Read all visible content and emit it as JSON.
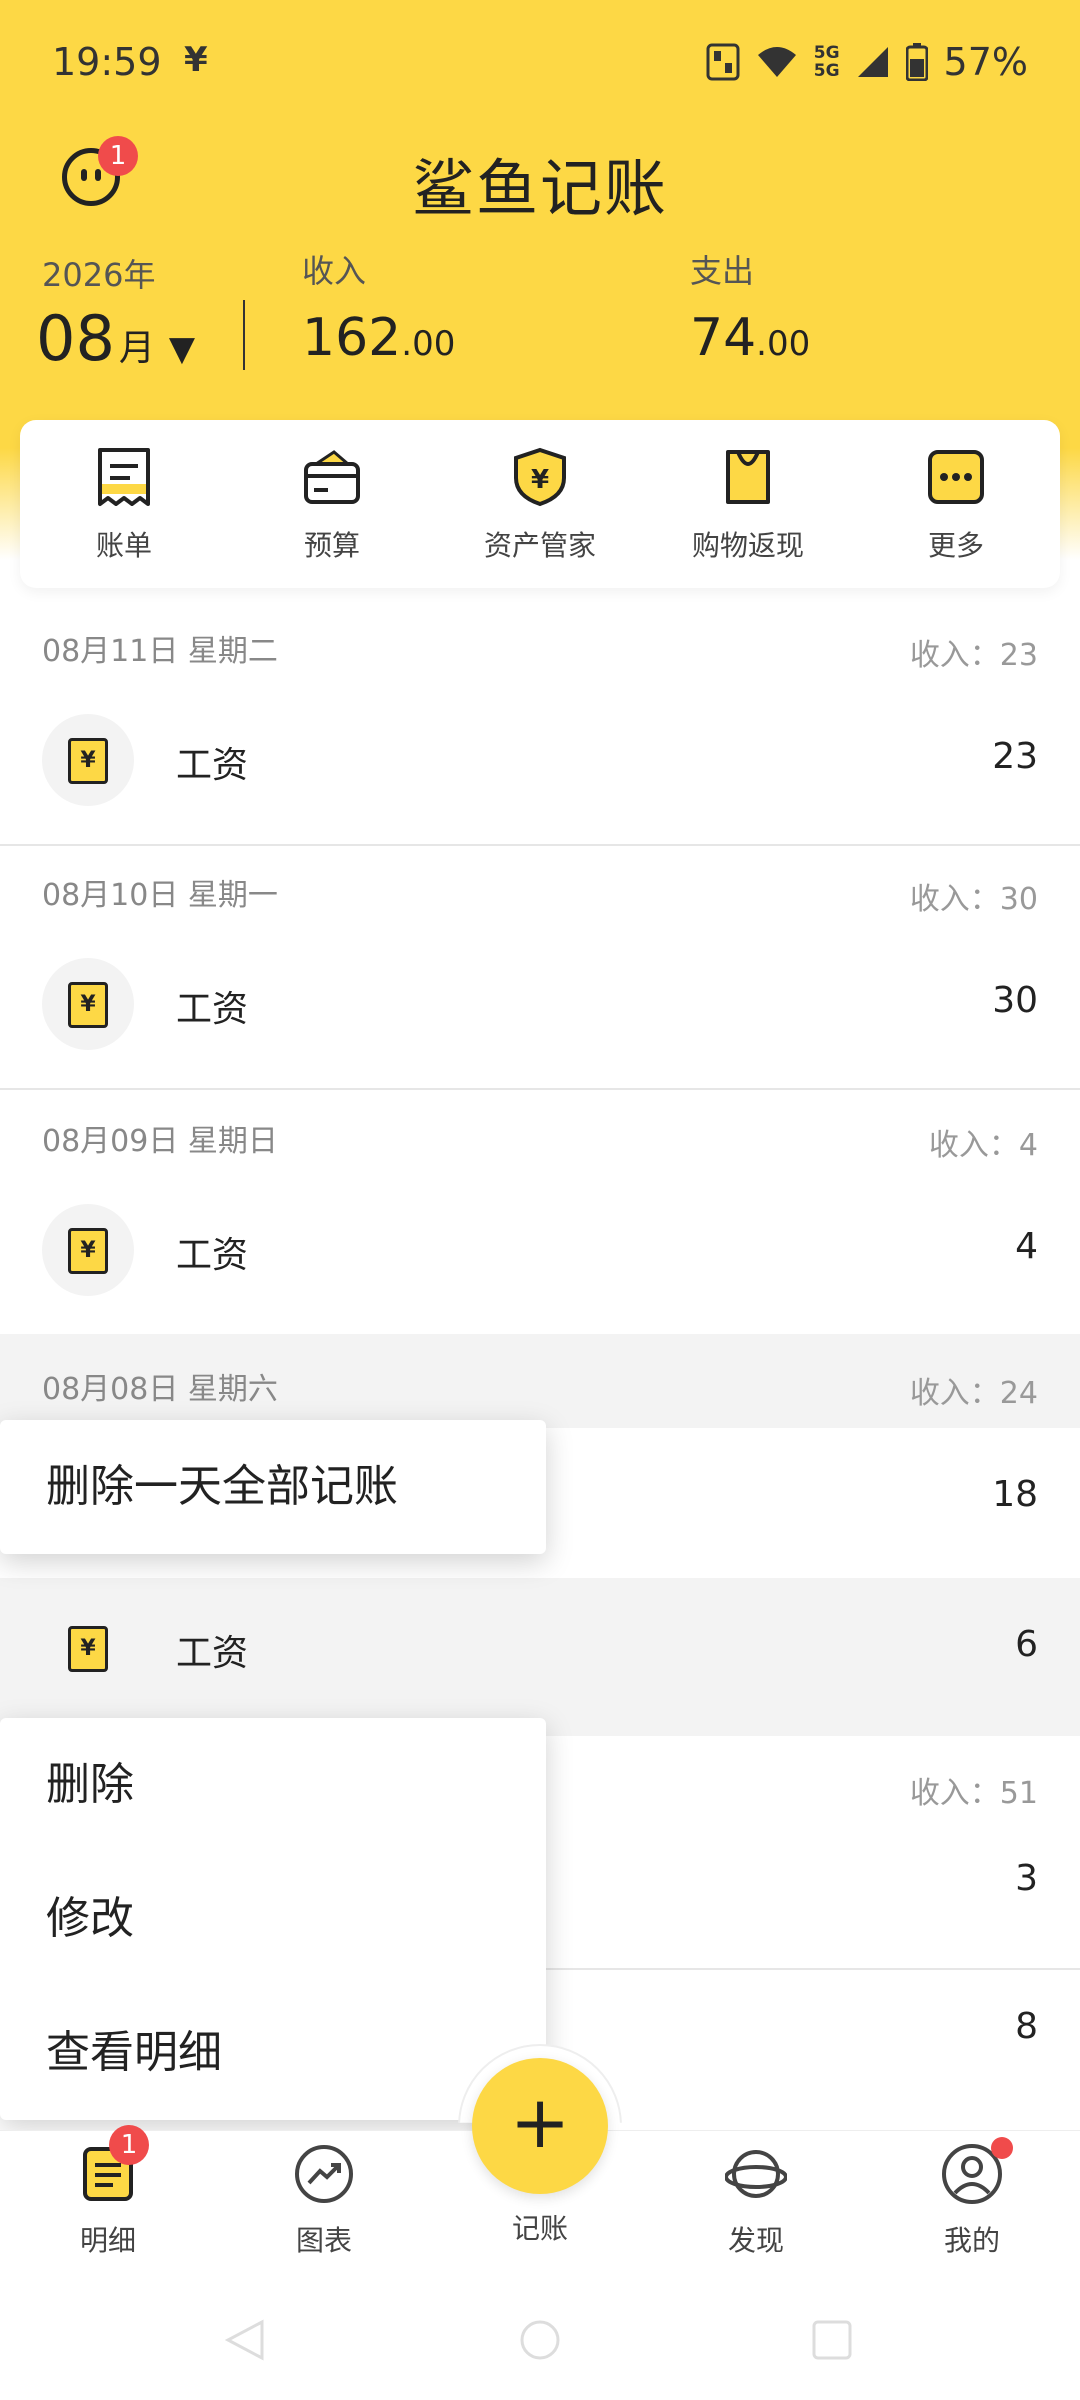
{
  "status_bar": {
    "time": "19:59",
    "yen_glyph": "¥",
    "battery": "57%",
    "net_label_top": "5G",
    "net_label_bottom": "5G"
  },
  "header": {
    "title": "鲨鱼记账",
    "notification_badge": "1",
    "year": "2026年",
    "month": "08",
    "month_unit": "月",
    "month_caret": "▼",
    "income_label": "收入",
    "income_int": "162",
    "income_dec": ".00",
    "expense_label": "支出",
    "expense_int": "74",
    "expense_dec": ".00"
  },
  "actions": [
    {
      "label": "账单",
      "icon": "bill-icon"
    },
    {
      "label": "预算",
      "icon": "wallet-icon"
    },
    {
      "label": "资产管家",
      "icon": "shield-yen-icon"
    },
    {
      "label": "购物返现",
      "icon": "shopping-bag-icon"
    },
    {
      "label": "更多",
      "icon": "more-icon"
    }
  ],
  "days": [
    {
      "date": "08月11日 星期二",
      "total": "收入：23",
      "entries": [
        {
          "name": "工资",
          "amount": "23"
        }
      ]
    },
    {
      "date": "08月10日 星期一",
      "total": "收入：30",
      "entries": [
        {
          "name": "工资",
          "amount": "30"
        }
      ]
    },
    {
      "date": "08月09日 星期日",
      "total": "收入：4",
      "entries": [
        {
          "name": "工资",
          "amount": "4"
        }
      ]
    },
    {
      "date": "08月08日 星期六",
      "total": "收入：24",
      "entries": [
        {
          "name": "",
          "amount": "18"
        },
        {
          "name": "工资",
          "amount": "6"
        }
      ]
    },
    {
      "date": "",
      "total": "收入：51",
      "entries": [
        {
          "name": "",
          "amount": "3"
        },
        {
          "name": "",
          "amount": "8"
        }
      ]
    }
  ],
  "popup_day": {
    "delete_all": "删除一天全部记账"
  },
  "popup_entry": {
    "delete": "删除",
    "edit": "修改",
    "details": "查看明细"
  },
  "bottom_nav": {
    "items": [
      {
        "label": "明细",
        "badge": "1"
      },
      {
        "label": "图表"
      },
      {
        "label": "记账"
      },
      {
        "label": "发现"
      },
      {
        "label": "我的"
      }
    ],
    "fab_glyph": "+"
  },
  "colors": {
    "brand_yellow": "#FDD845",
    "badge_red": "#F04B4B"
  }
}
